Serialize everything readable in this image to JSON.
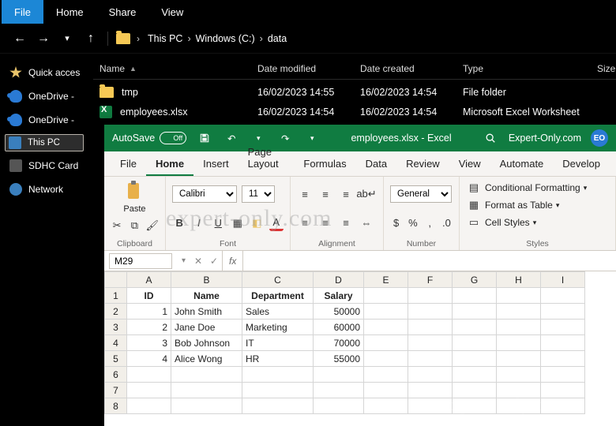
{
  "explorer": {
    "tabs": [
      "File",
      "Home",
      "Share",
      "View"
    ],
    "active_tab": "File",
    "breadcrumb": [
      "This PC",
      "Windows  (C:)",
      "data"
    ],
    "sidebar": [
      {
        "label": "Quick acces",
        "icon": "star",
        "sel": false
      },
      {
        "label": "OneDrive - ",
        "icon": "cloud",
        "sel": false
      },
      {
        "label": "OneDrive - ",
        "icon": "cloud",
        "sel": false
      },
      {
        "label": "This PC",
        "icon": "pc",
        "sel": true
      },
      {
        "label": "SDHC Card",
        "icon": "sd",
        "sel": false
      },
      {
        "label": "Network",
        "icon": "net",
        "sel": false
      }
    ],
    "columns": [
      "Name",
      "Date modified",
      "Date created",
      "Type",
      "Size"
    ],
    "rows": [
      {
        "name": "tmp",
        "modified": "16/02/2023 14:55",
        "created": "16/02/2023 14:54",
        "type": "File folder",
        "size": "",
        "icon": "folder"
      },
      {
        "name": "employees.xlsx",
        "modified": "16/02/2023 14:54",
        "created": "16/02/2023 14:54",
        "type": "Microsoft Excel Worksheet",
        "size": "",
        "icon": "xls"
      }
    ]
  },
  "excel": {
    "autosave_label": "AutoSave",
    "autosave_state": "Off",
    "title": "employees.xlsx  -  Excel",
    "brand": "Expert-Only.com",
    "badge": "EO",
    "menu": [
      "File",
      "Home",
      "Insert",
      "Page Layout",
      "Formulas",
      "Data",
      "Review",
      "View",
      "Automate",
      "Develop"
    ],
    "menu_active": "Home",
    "ribbon": {
      "clipboard": "Clipboard",
      "font": "Font",
      "font_name": "Calibri",
      "font_size": "11",
      "alignment": "Alignment",
      "number": "Number",
      "number_format": "General",
      "styles": "Styles",
      "cond_fmt": "Conditional Formatting",
      "fmt_table": "Format as Table",
      "cell_styles": "Cell Styles",
      "paste": "Paste"
    },
    "namebox": "M29",
    "fx_label": "fx",
    "columns": [
      "A",
      "B",
      "C",
      "D",
      "E",
      "F",
      "G",
      "H",
      "I"
    ],
    "headers": [
      "ID",
      "Name",
      "Department",
      "Salary"
    ],
    "data": [
      {
        "id": "1",
        "name": "John Smith",
        "dept": "Sales",
        "salary": "50000"
      },
      {
        "id": "2",
        "name": "Jane Doe",
        "dept": "Marketing",
        "salary": "60000"
      },
      {
        "id": "3",
        "name": "Bob Johnson",
        "dept": "IT",
        "salary": "70000"
      },
      {
        "id": "4",
        "name": "Alice Wong",
        "dept": "HR",
        "salary": "55000"
      }
    ],
    "blank_rows": 3
  },
  "watermark": "expert-only.com"
}
